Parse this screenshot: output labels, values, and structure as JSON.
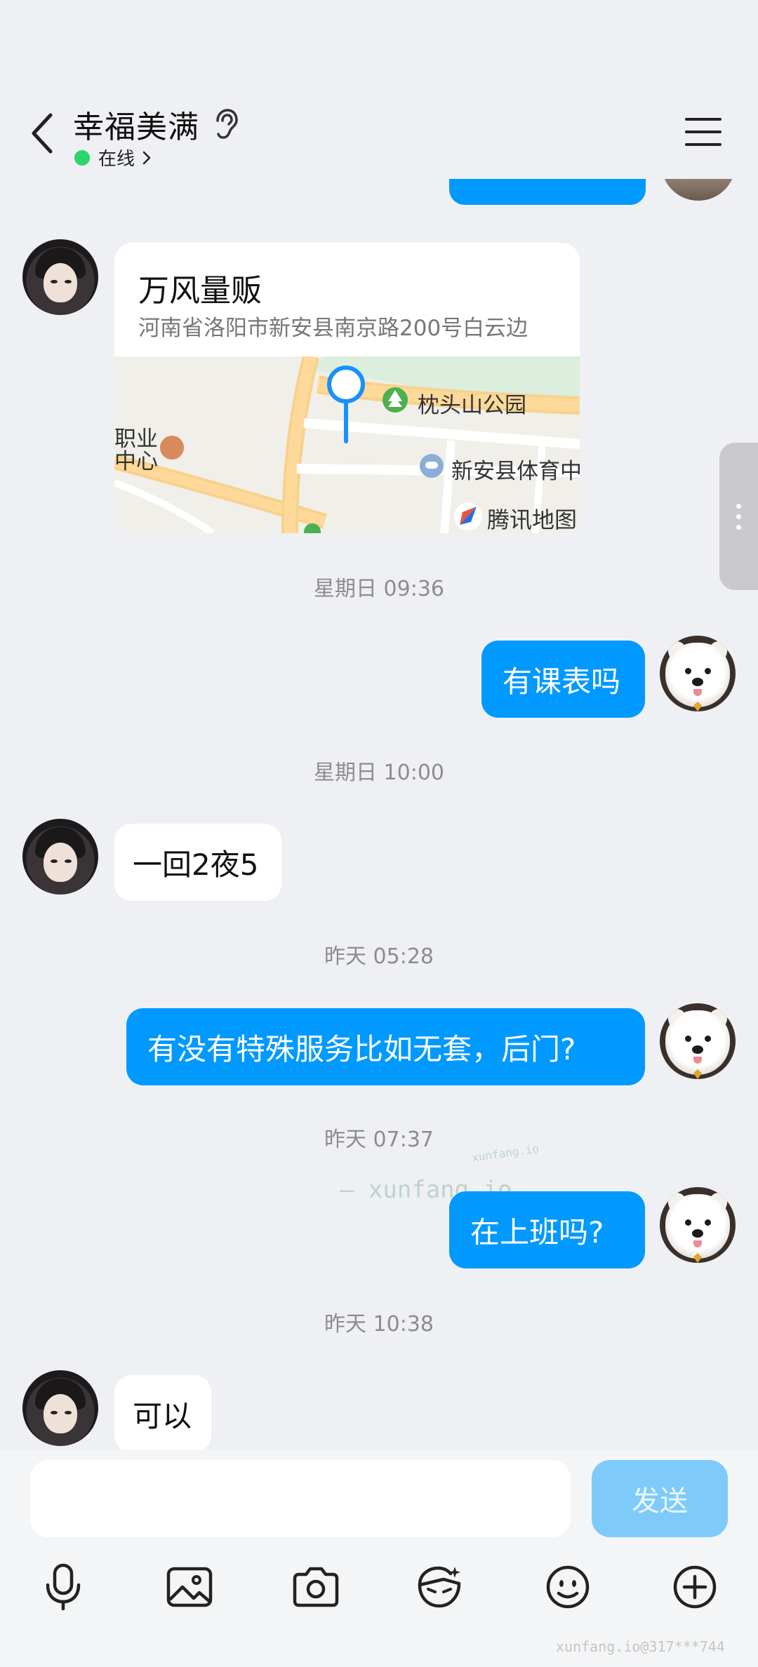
{
  "header": {
    "contact_name": "幸福美满",
    "status_text": "在线",
    "status_color": "#2bd56a",
    "icons": [
      "back-chevron-icon",
      "ear-icon",
      "chevron-right-icon",
      "menu-icon"
    ]
  },
  "messages": {
    "location": {
      "name": "万风量贩",
      "address": "河南省洛阳市新安县南京路200号白云边",
      "map_labels": {
        "park": "枕头山公园",
        "stadium": "新安县体育中",
        "left_top": "职业",
        "left_bottom": "中心",
        "logo": "腾讯地图"
      }
    },
    "time_1": "星期日 09:36",
    "msg_1": "有课表吗",
    "time_2": "星期日 10:00",
    "msg_2": "一回2夜5",
    "time_3": "昨天 05:28",
    "msg_3": "有没有特殊服务比如无套，后门?",
    "time_4": "昨天 07:37",
    "msg_4": "在上班吗?",
    "time_5": "昨天 10:38",
    "msg_5": "可以"
  },
  "watermarks": {
    "center": "— xunfang.io",
    "center_small": "xunfang.io",
    "footer": "xunfang.io@317***744"
  },
  "input": {
    "value": "",
    "placeholder": "",
    "send_label": "发送"
  },
  "colors": {
    "outgoing_bubble": "#0099ff",
    "incoming_bubble": "#ffffff",
    "background": "#eff0f4",
    "send_disabled": "#7ecbfa"
  },
  "toolbar": [
    "microphone-icon",
    "image-icon",
    "camera-icon",
    "sticker-icon",
    "emoji-icon",
    "plus-icon"
  ]
}
